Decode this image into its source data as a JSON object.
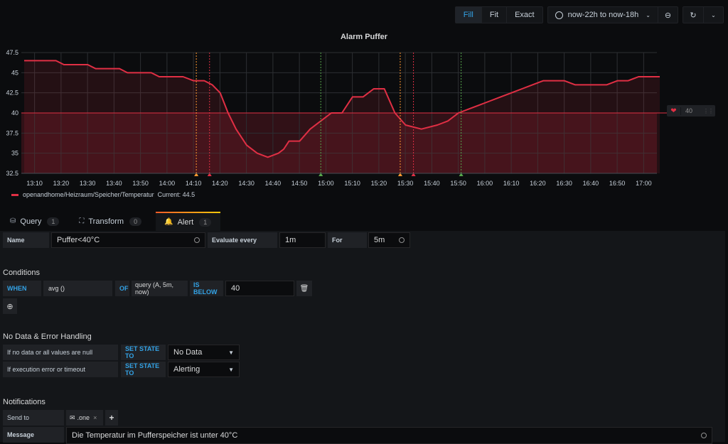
{
  "toolbar": {
    "fill_label": "Fill",
    "fit_label": "Fit",
    "exact_label": "Exact",
    "time_range": "now-22h to now-18h",
    "active": "Fill"
  },
  "chart_data": {
    "type": "line",
    "title": "Alarm Puffer",
    "xlabel": "",
    "ylabel": "",
    "x_ticks": [
      "13:10",
      "13:20",
      "13:30",
      "13:40",
      "13:50",
      "14:00",
      "14:10",
      "14:20",
      "14:30",
      "14:40",
      "14:50",
      "15:00",
      "15:10",
      "15:20",
      "15:30",
      "15:40",
      "15:50",
      "16:00",
      "16:10",
      "16:20",
      "16:30",
      "16:40",
      "16:50",
      "17:00"
    ],
    "y_ticks": [
      "32.5",
      "35",
      "37.5",
      "40",
      "42.5",
      "45",
      "47.5"
    ],
    "ylim": [
      32.5,
      47.5
    ],
    "xlim_minutes": [
      0,
      240
    ],
    "grid": true,
    "threshold": {
      "value": 40,
      "op": "below",
      "color": "#e02f44"
    },
    "series": [
      {
        "name": "openandhome/Heizraum/Speicher/Temperatur",
        "color": "#e02f44",
        "x_minutes_from_13_05": [
          0,
          12,
          15,
          24,
          27,
          36,
          39,
          48,
          51,
          60,
          64,
          68,
          71,
          74,
          77,
          80,
          84,
          88,
          92,
          96,
          98,
          100,
          104,
          108,
          112,
          116,
          120,
          124,
          128,
          132,
          136,
          140,
          144,
          150,
          156,
          160,
          164,
          168,
          172,
          176,
          180,
          184,
          188,
          192,
          196,
          200,
          204,
          208,
          212,
          216,
          220,
          224,
          228,
          232,
          236,
          240
        ],
        "values": [
          46.5,
          46.5,
          46,
          46,
          45.5,
          45.5,
          45,
          45,
          44.5,
          44.5,
          44,
          44,
          43.5,
          42.5,
          40,
          38,
          36,
          35,
          34.5,
          35,
          35.5,
          36.5,
          36.5,
          38,
          39,
          40,
          40,
          42,
          42,
          43,
          43,
          40,
          38.5,
          38,
          38.5,
          39,
          40,
          40.5,
          41,
          41.5,
          42,
          42.5,
          43,
          43.5,
          44,
          44,
          44,
          43.5,
          43.5,
          43.5,
          43.5,
          44,
          44,
          44.5,
          44.5,
          44.5
        ]
      }
    ],
    "annotations": [
      {
        "time": "14:10",
        "state": "pending",
        "color": "#ff9830"
      },
      {
        "time": "14:15",
        "state": "alerting",
        "color": "#e02f44"
      },
      {
        "time": "14:57",
        "state": "ok",
        "color": "#56a64b"
      },
      {
        "time": "15:27",
        "state": "pending",
        "color": "#ff9830"
      },
      {
        "time": "15:32",
        "state": "alerting",
        "color": "#e02f44"
      },
      {
        "time": "15:50",
        "state": "ok",
        "color": "#56a64b"
      }
    ],
    "legend": {
      "label": "openandhome/Heizraum/Speicher/Temperatur",
      "current": "Current: 44.5",
      "placement": "bottom-left"
    }
  },
  "threshold_handle": {
    "value": "40"
  },
  "tabs": [
    {
      "label": "Query",
      "count": "1"
    },
    {
      "label": "Transform",
      "count": "0"
    },
    {
      "label": "Alert",
      "count": "1",
      "active": true
    }
  ],
  "rule": {
    "name_label": "Name",
    "name_value": "Puffer<40°C",
    "evaluate_label": "Evaluate every",
    "evaluate_value": "1m",
    "for_label": "For",
    "for_value": "5m"
  },
  "conditions": {
    "title": "Conditions",
    "when": "WHEN",
    "reducer": "avg ()",
    "of": "OF",
    "query": "query (A, 5m, now)",
    "evaluator": "IS BELOW",
    "threshold": "40"
  },
  "nodata": {
    "title": "No Data & Error Handling",
    "rows": [
      {
        "label": "If no data or all values are null",
        "action": "SET STATE TO",
        "value": "No Data"
      },
      {
        "label": "If execution error or timeout",
        "action": "SET STATE TO",
        "value": "Alerting"
      }
    ]
  },
  "notifications": {
    "title": "Notifications",
    "send_to_label": "Send to",
    "channel": ".one",
    "message_label": "Message",
    "message": "Die Temperatur im Pufferspeicher ist unter 40°C"
  }
}
